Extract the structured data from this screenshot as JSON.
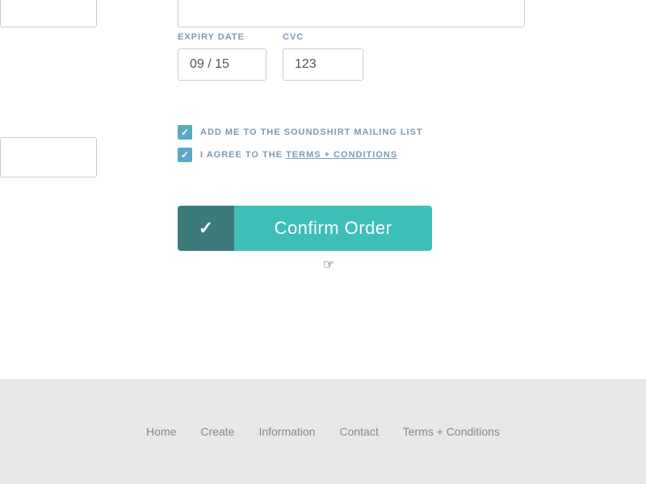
{
  "form": {
    "expiry_label": "EXPIRY DATE",
    "cvc_label": "CVC",
    "expiry_value": "09 / 15",
    "cvc_value": "123",
    "checkbox_mailing": "ADD ME TO THE SOUNDSHIRT MAILING LIST",
    "checkbox_terms_prefix": "I AGREE TO THE ",
    "checkbox_terms_link": "TERMS + CONDITIONS",
    "confirm_button_label": "Confirm Order"
  },
  "footer": {
    "nav_items": [
      {
        "label": "Home",
        "href": "#"
      },
      {
        "label": "Create",
        "href": "#"
      },
      {
        "label": "Information",
        "href": "#"
      },
      {
        "label": "Contact",
        "href": "#"
      },
      {
        "label": "Terms + Conditions",
        "href": "#"
      }
    ]
  },
  "colors": {
    "teal_dark": "#3d7a7a",
    "teal_light": "#3dbfb8",
    "label_blue": "#7a9bb5"
  }
}
